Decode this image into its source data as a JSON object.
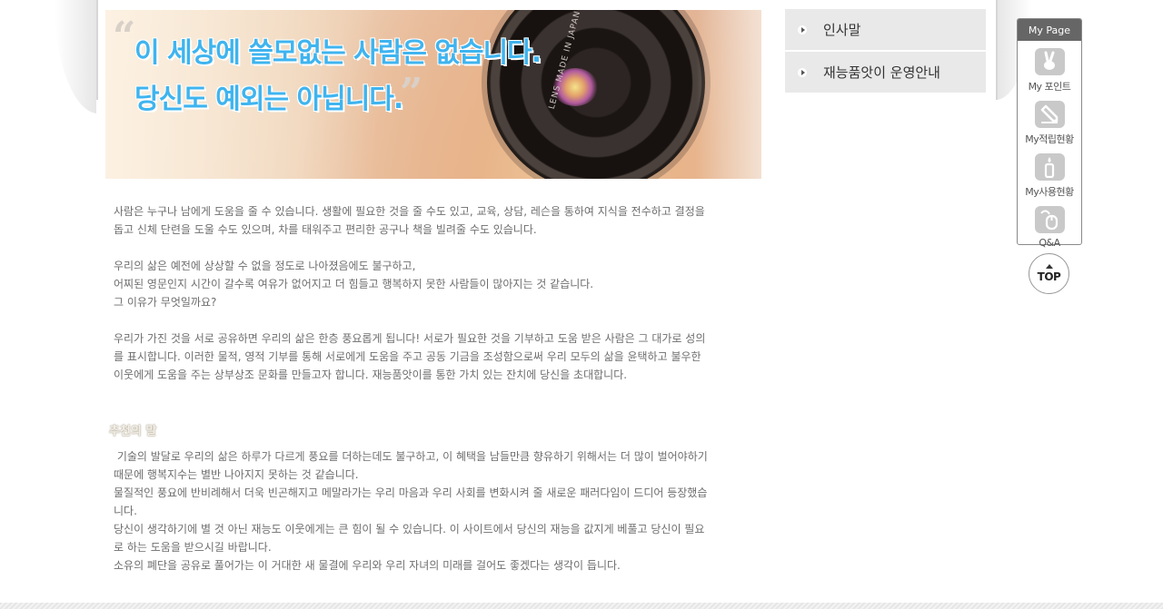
{
  "hero": {
    "quote_line1": "이 세상에 쓸모없는 사람은 없습니다.",
    "quote_line2": "당신도 예외는 아닙니다.",
    "lens_text": "LENS MADE IN JAPAN"
  },
  "intro": {
    "paragraphs": [
      [
        "사람은 누구나 남에게 도움을 줄 수 있습니다. 생활에 필요한 것을 줄 수도 있고, 교육, 상담, 레슨을 통하여 지식을 전수하고 결정을",
        "돕고 신체 단련을 도울 수도 있으며, 차를 태워주고 편리한 공구나 책을 빌려줄 수도 있습니다."
      ],
      [
        "우리의 삶은 예전에 상상할 수 없을 정도로 나아졌음에도 불구하고,",
        "어찌된 영문인지 시간이 갈수록 여유가 없어지고 더 힘들고 행복하지 못한 사람들이 많아지는 것 같습니다.",
        "그 이유가 무엇일까요?"
      ],
      [
        "우리가 가진 것을 서로 공유하면 우리의 삶은 한층 풍요롭게 됩니다! 서로가 필요한 것을 기부하고 도움 받은 사람은 그 대가로 성의",
        "를 표시합니다. 이러한 물적, 영적 기부를 통해 서로에게 도움을 주고 공동 기금을 조성함으로써 우리 모두의 삶을 윤택하고 불우한",
        "이웃에게 도움을 주는 상부상조 문화를 만들고자 합니다.  재능품앗이를 통한 가치 있는 잔치에 당신을 초대합니다."
      ]
    ]
  },
  "recommend": {
    "title": "추천의 말",
    "lines": [
      " 기술의 발달로 우리의 삶은 하루가 다르게 풍요를 더하는데도 불구하고, 이 혜택을 남들만큼 향유하기 위해서는 더 많이 벌어야하기",
      "때문에 행복지수는 별반 나아지지 못하는 것 같습니다.",
      "물질적인 풍요에 반비례해서 더욱 빈곤해지고 메말라가는 우리 마음과 우리 사회를 변화시켜 줄 새로운 패러다임이 드디어 등장했습",
      "니다.",
      "당신이 생각하기에 별 것 아닌 재능도 이웃에게는 큰 힘이 될 수 있습니다. 이 사이트에서 당신의 재능을 값지게 베풀고 당신이 필요",
      "로 하는 도움을 받으시길 바랍니다.",
      "소유의 폐단을 공유로 풀어가는 이 거대한 새 물결에 우리와 우리 자녀의 미래를 걸어도 좋겠다는 생각이 듭니다."
    ]
  },
  "submenu": {
    "items": [
      {
        "label": "인사말"
      },
      {
        "label": "재능품앗이 운영안내"
      }
    ]
  },
  "mypage": {
    "title": "My Page",
    "items": [
      {
        "label": "My 포인트",
        "icon": "victory-hand-icon"
      },
      {
        "label": "My적립현황",
        "icon": "pencil-icon"
      },
      {
        "label": "My사용현황",
        "icon": "candle-icon"
      },
      {
        "label": "Q&A",
        "icon": "mouse-icon"
      }
    ],
    "top_label": "TOP"
  },
  "colors": {
    "quote": "#3fb4ef",
    "menu_bg": "#e9e9e9",
    "panel_header": "#666666"
  }
}
